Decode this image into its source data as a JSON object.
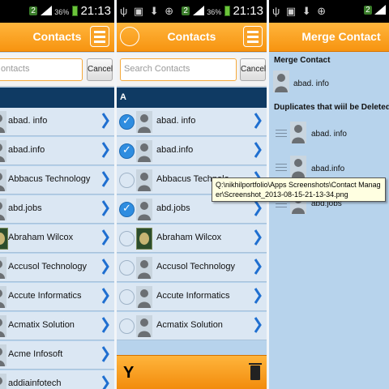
{
  "status_bar": {
    "network": "2",
    "battery_pct": "36%",
    "time": "21:13",
    "left_icons": "ψ ▣ ⬇ ⊕"
  },
  "panel1": {
    "title": "Contacts",
    "search_placeholder": "ontacts",
    "cancel_label": "Cancel",
    "rows": [
      {
        "name": "abad. info"
      },
      {
        "name": "abad.info"
      },
      {
        "name": "Abbacus Technology"
      },
      {
        "name": "abd.jobs"
      },
      {
        "name": "Abraham Wilcox"
      },
      {
        "name": "Accusol Technology"
      },
      {
        "name": "Accute Informatics"
      },
      {
        "name": "Acmatix Solution"
      },
      {
        "name": "Acme Infosoft"
      },
      {
        "name": "addiainfotech"
      }
    ]
  },
  "panel2": {
    "title": "Contacts",
    "search_placeholder": "Search Contacts",
    "cancel_label": "Cancel",
    "section_letter": "A",
    "rows": [
      {
        "name": "abad. info",
        "checked": true
      },
      {
        "name": "abad.info",
        "checked": true
      },
      {
        "name": "Abbacus Technolo",
        "checked": false
      },
      {
        "name": "abd.jobs",
        "checked": true
      },
      {
        "name": "Abraham Wilcox",
        "checked": false
      },
      {
        "name": "Accusol Technology",
        "checked": false
      },
      {
        "name": "Accute Informatics",
        "checked": false
      },
      {
        "name": "Acmatix Solution",
        "checked": false
      }
    ]
  },
  "panel3": {
    "title": "Merge Contact",
    "merge_label": "Merge Contact",
    "merge_contact_name": "abad. info",
    "duplicates_label": "Duplicates that wiil be Deleted",
    "duplicates": [
      {
        "name": "abad. info"
      },
      {
        "name": "abad.info"
      },
      {
        "name": "abd.jobs"
      }
    ]
  },
  "tooltip": {
    "text": "Q:\\nikhilportfolio\\Apps Screenshots\\Contact Manager\\Screenshot_2013-08-15-21-13-34.png"
  },
  "colors": {
    "header_orange": "#f79410",
    "list_bg": "#dbe7f3",
    "section_navy": "#0f3a63",
    "check_blue": "#2f8de0",
    "chevron_blue": "#1f6fd0"
  }
}
